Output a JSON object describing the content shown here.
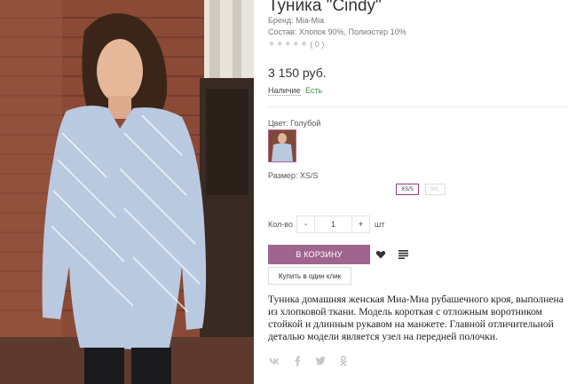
{
  "product": {
    "title": "Туника \"Cindy\"",
    "brand": "Бренд: Mia-Mia",
    "composition": "Состав: Хлопок 90%, Полиэстер 10%",
    "rating_count": "( 0 )",
    "stars": 5,
    "price": "3 150 руб.",
    "availability_label": "Наличие",
    "availability_value": "Есть"
  },
  "options": {
    "color_label": "Цвет: Голубой",
    "size_label": "Размер: XS/S",
    "sizes": [
      "XS/S",
      "M/L"
    ]
  },
  "quantity": {
    "label": "Кол-во",
    "minus": "-",
    "plus": "+",
    "value": "1",
    "unit": "шт"
  },
  "actions": {
    "cart": "В КОРЗИНУ",
    "one_click": "Купить в один клик"
  },
  "description": "Туника домашняя женская Миа-Миа рубашечного кроя, выполнена из хлопковой ткани. Модель короткая с отложным воротником стойкой и длинным рукавом на манжете. Главной отличительной деталью модели является узел на передней полочки.",
  "icons": [
    "vk-icon",
    "facebook-icon",
    "twitter-icon",
    "odnoklassniki-icon"
  ],
  "colors": {
    "accent": "#a0658f",
    "in_stock": "#3a9a3a"
  }
}
